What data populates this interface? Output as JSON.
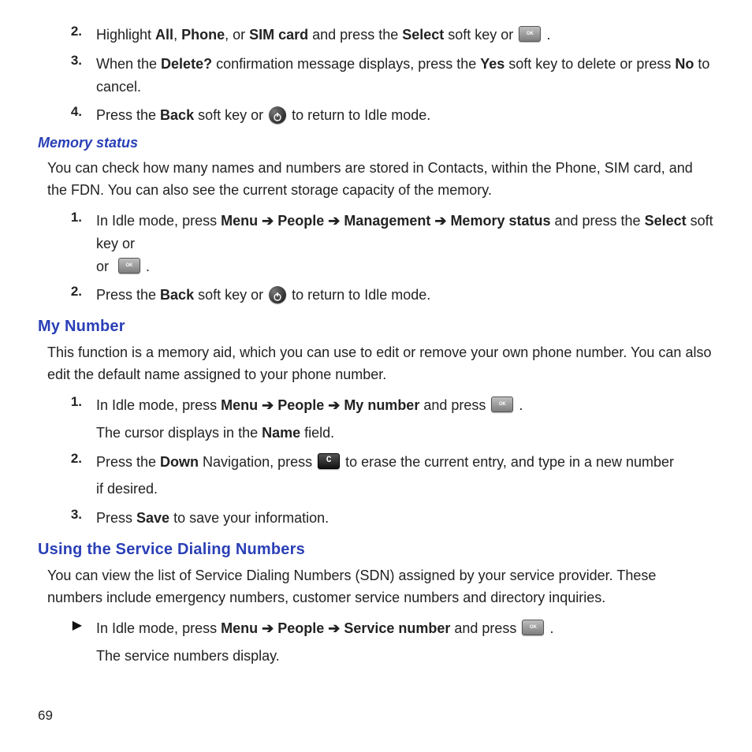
{
  "page_number": "69",
  "section_prev": {
    "items": [
      {
        "num": "2.",
        "pre": "Highlight ",
        "b1": "All",
        "mid1": ", ",
        "b2": "Phone",
        "mid2": ", or ",
        "b3": "SIM card",
        "mid3": " and press the ",
        "b4": "Select",
        "post": " soft key or ",
        "icon": "ok",
        "end": " ."
      },
      {
        "num": "3.",
        "pre": "When the ",
        "b1": "Delete?",
        "mid1": " confirmation message displays, press the ",
        "b2": "Yes",
        "mid2": " soft key to delete or press ",
        "b3": "No",
        "post": " to cancel."
      },
      {
        "num": "4.",
        "pre": "Press the ",
        "b1": "Back",
        "mid1": " soft key or ",
        "icon": "back",
        "post": " to return to Idle mode."
      }
    ]
  },
  "memory_status": {
    "heading": "Memory status",
    "intro": "You can check how many names and numbers are stored in Contacts, within the Phone, SIM card, and the FDN. You can also see the current storage capacity of the memory.",
    "items": [
      {
        "num": "1.",
        "pre": "In Idle mode, press ",
        "nav": [
          "Menu",
          "People",
          "Management",
          "Memory status"
        ],
        "mid": " and press the ",
        "b1": "Select",
        "post": " soft key or ",
        "icon": "ok",
        "end": " ."
      },
      {
        "num": "2.",
        "pre": "Press the ",
        "b1": "Back",
        "mid1": " soft key or ",
        "icon": "back",
        "post": " to return to Idle mode."
      }
    ]
  },
  "my_number": {
    "heading": "My Number",
    "intro": "This function is a memory aid, which you can use to edit or remove your own phone number. You can also edit the default name assigned to your phone number.",
    "items": [
      {
        "num": "1.",
        "pre": "In Idle mode, press ",
        "nav": [
          "Menu",
          "People",
          "My number"
        ],
        "mid": " and press ",
        "icon": "ok",
        "end": " .",
        "line2_pre": "The cursor displays in the ",
        "line2_b": "Name",
        "line2_post": " field."
      },
      {
        "num": "2.",
        "pre": "Press the ",
        "b1": "Down",
        "mid1": " Navigation, press ",
        "icon": "c",
        "post": " to erase the current entry, and type in a new number",
        "line2_plain": "if desired."
      },
      {
        "num": "3.",
        "pre": "Press ",
        "b1": "Save",
        "post": " to save your information."
      }
    ]
  },
  "sdn": {
    "heading": "Using the Service Dialing Numbers",
    "intro": "You can view the list of Service Dialing Numbers (SDN) assigned by your service provider. These numbers include emergency numbers, customer service numbers and directory inquiries.",
    "item": {
      "pre": "In Idle mode, press ",
      "nav": [
        "Menu",
        "People",
        "Service number"
      ],
      "mid": " and press ",
      "icon": "ok",
      "end": " .",
      "line2": "The service numbers display."
    }
  }
}
